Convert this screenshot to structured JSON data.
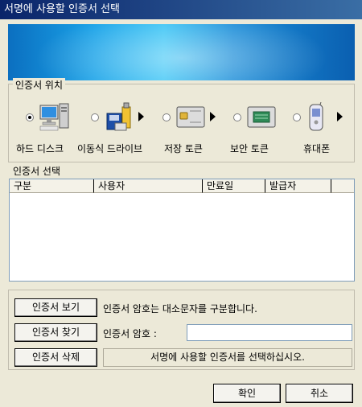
{
  "window": {
    "title": "서명에 사용할 인증서 선택"
  },
  "location": {
    "legend": "인증서 위치",
    "devices": [
      {
        "label": "하드 디스크",
        "icon": "computer-icon",
        "selected": true
      },
      {
        "label": "이동식 드라이브",
        "icon": "usb-drive-icon",
        "selected": false
      },
      {
        "label": "저장 토큰",
        "icon": "smart-card-icon",
        "selected": false
      },
      {
        "label": "보안 토큰",
        "icon": "security-token-icon",
        "selected": false
      },
      {
        "label": "휴대폰",
        "icon": "mobile-phone-icon",
        "selected": false
      }
    ]
  },
  "certificates": {
    "section_label": "인증서 선택",
    "columns": [
      "구분",
      "사용자",
      "만료일",
      "발급자"
    ],
    "rows": []
  },
  "actions": {
    "view_button": "인증서 보기",
    "find_button": "인증서 찾기",
    "delete_button": "인증서 삭제",
    "password_hint": "인증서 암호는 대소문자를 구분합니다.",
    "password_label": "인증서 암호 :",
    "password_value": "",
    "status_message": "서명에 사용할 인증서를 선택하십시오."
  },
  "footer": {
    "ok_button": "확인",
    "cancel_button": "취소"
  },
  "colors": {
    "title_bar": "#0a246a",
    "banner": "#1aa3e8",
    "window_bg": "#ece9d8"
  }
}
